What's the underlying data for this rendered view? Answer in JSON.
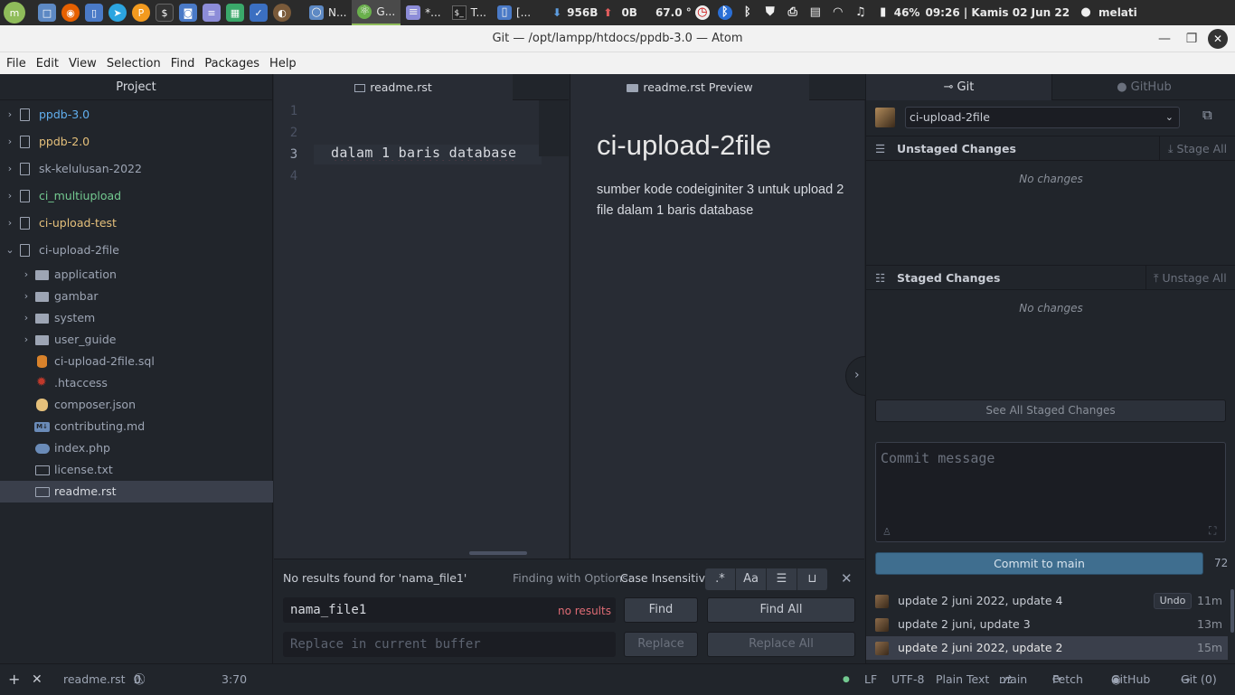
{
  "system": {
    "taskbar": [
      {
        "label": "N...",
        "icon": "chromium-icon"
      },
      {
        "label": "G...",
        "icon": "atom-icon",
        "active": true
      },
      {
        "label": "*...",
        "icon": "text-editor-icon"
      },
      {
        "label": "T...",
        "icon": "terminal-icon"
      },
      {
        "label": "[...",
        "icon": "file-manager-icon"
      }
    ],
    "net_down": "956B",
    "net_up": "0B",
    "temperature": "67.0 °",
    "battery": "46%",
    "clock": "09:26 | Kamis 02 Jun 22",
    "user": "melati"
  },
  "window": {
    "title": "Git — /opt/lampp/htdocs/ppdb-3.0 — Atom"
  },
  "menu": [
    "File",
    "Edit",
    "View",
    "Selection",
    "Find",
    "Packages",
    "Help"
  ],
  "tree": {
    "header": "Project",
    "projects": [
      {
        "name": "ppdb-3.0",
        "color": "#61afef"
      },
      {
        "name": "ppdb-2.0",
        "color": "#e5c07b"
      },
      {
        "name": "sk-kelulusan-2022",
        "color": "#9da5b4"
      },
      {
        "name": "ci_multiupload",
        "color": "#73c990"
      },
      {
        "name": "ci-upload-test",
        "color": "#e5c07b"
      },
      {
        "name": "ci-upload-2file",
        "color": "#9da5b4"
      }
    ],
    "folders": [
      "application",
      "gambar",
      "system",
      "user_guide"
    ],
    "files": [
      "ci-upload-2file.sql",
      ".htaccess",
      "composer.json",
      "contributing.md",
      "index.php",
      "license.txt",
      "readme.rst"
    ],
    "selected": "readme.rst"
  },
  "editor": {
    "tab": "readme.rst",
    "line_numbers": [
      "1",
      "2",
      "3",
      "4"
    ],
    "code_line": "dalam 1 baris database",
    "preview_tab": "readme.rst Preview",
    "preview_heading": "ci-upload-2file",
    "preview_text": "sumber kode codeiginiter 3 untuk upload 2 file dalam 1 baris database"
  },
  "find": {
    "status": "No results found for 'nama_file1'",
    "options_label": "Finding with Options:",
    "options_value": "Case Insensitive",
    "find_value": "nama_file1",
    "no_results": "no results",
    "replace_placeholder": "Replace in current buffer",
    "find_button": "Find",
    "find_all_button": "Find All",
    "replace_button": "Replace",
    "replace_all_button": "Replace All",
    "opt_regex": ".*",
    "opt_case": "Aa"
  },
  "git": {
    "tab_git": "Git",
    "tab_github": "GitHub",
    "branch": "ci-upload-2file",
    "unstaged_title": "Unstaged Changes",
    "stage_all": "Stage All",
    "staged_title": "Staged Changes",
    "unstage_all": "Unstage All",
    "no_changes": "No changes",
    "see_all_staged": "See All Staged Changes",
    "commit_placeholder": "Commit message",
    "commit_button": "Commit to main",
    "char_count": "72",
    "commits": [
      {
        "message": "update 2 juni 2022, update 4",
        "time": "11m",
        "undo": "Undo"
      },
      {
        "message": "update 2 juni, update 3",
        "time": "13m"
      },
      {
        "message": "update 2 juni 2022, update 2",
        "time": "15m"
      }
    ]
  },
  "status": {
    "file": "readme.rst",
    "errors": "0",
    "warnings": "0",
    "infos": "0",
    "cursor": "3:70",
    "line_ending": "LF",
    "encoding": "UTF-8",
    "grammar": "Plain Text",
    "branch": "main",
    "fetch": "Fetch",
    "github": "GitHub",
    "git": "Git (0)"
  },
  "colors": {
    "accent": "#3f6e8f",
    "background": "#21252b",
    "editor": "#282c34"
  }
}
